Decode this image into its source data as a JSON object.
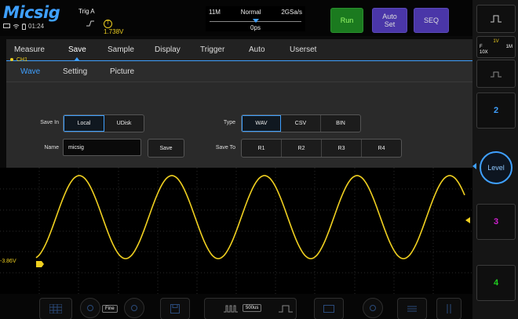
{
  "brand": {
    "logo_text": "Micsig"
  },
  "status": {
    "time": "01:24"
  },
  "trigger": {
    "title": "Trig A",
    "level_value": "1.738V",
    "level_icon": "T"
  },
  "acquisition": {
    "memory": "11M",
    "mode": "Normal",
    "sample_rate": "2GSa/s",
    "time_offset": "0ps"
  },
  "top_buttons": {
    "run": "Run",
    "auto_set": "Auto\nSet",
    "seq": "SEQ"
  },
  "menu": {
    "tabs": [
      "Measure",
      "Save",
      "Sample",
      "Display",
      "Trigger",
      "Auto",
      "Userset"
    ],
    "active_tab": "Save",
    "subtabs": [
      "Wave",
      "Setting",
      "Picture"
    ],
    "active_subtab": "Wave"
  },
  "save_panel": {
    "channel": "CH1",
    "save_in_label": "Save In",
    "save_in_options": [
      "Local",
      "UDisk"
    ],
    "save_in_selected": "Local",
    "name_label": "Name",
    "name_value": "micsig",
    "save_button": "Save",
    "type_label": "Type",
    "type_options": [
      "WAV",
      "CSV",
      "BIN"
    ],
    "type_selected": "WAV",
    "save_to_label": "Save To",
    "save_to_options": [
      "R1",
      "R2",
      "R3",
      "R4"
    ]
  },
  "right_panel": {
    "info_line1": "1V",
    "info_line2_left": "F",
    "info_line2_right": "1M",
    "info_line3": "10X",
    "ch2": "2",
    "level": "Level",
    "ch3": "3",
    "ch4": "4"
  },
  "waveform": {
    "channel_offset": "-3.86V"
  },
  "bottom_bar": {
    "fine_label": "Fine",
    "timebase": "500us"
  },
  "colors": {
    "accent": "#3fa0ff",
    "ch1": "#f0d020",
    "ch2": "#3fa0ff",
    "ch3": "#d020d0",
    "ch4": "#20d020",
    "run": "#1b7a1f",
    "purple_button": "#4a36a8"
  }
}
